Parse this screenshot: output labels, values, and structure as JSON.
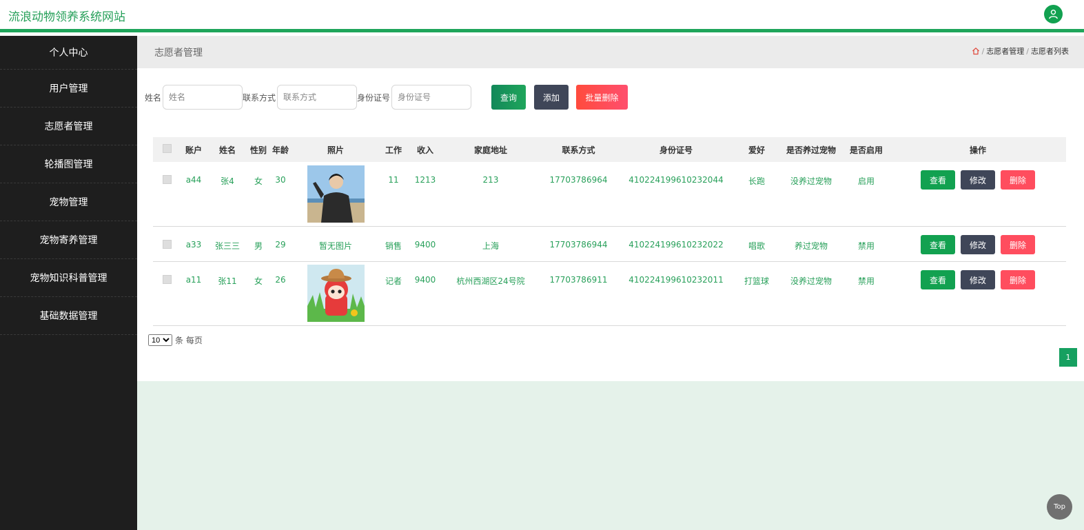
{
  "site_title": "流浪动物领养系统网站",
  "sidebar": {
    "items": [
      {
        "label": "个人中心"
      },
      {
        "label": "用户管理"
      },
      {
        "label": "志愿者管理"
      },
      {
        "label": "轮播图管理"
      },
      {
        "label": "宠物管理"
      },
      {
        "label": "宠物寄养管理"
      },
      {
        "label": "宠物知识科普管理"
      },
      {
        "label": "基础数据管理"
      }
    ]
  },
  "page": {
    "title": "志愿者管理",
    "breadcrumb": [
      "志愿者管理",
      "志愿者列表"
    ]
  },
  "search": {
    "name_label": "姓名",
    "name_placeholder": "姓名",
    "phone_label": "联系方式",
    "phone_placeholder": "联系方式",
    "id_label": "身份证号",
    "id_placeholder": "身份证号",
    "query_btn": "查询",
    "add_btn": "添加",
    "batch_delete_btn": "批量删除"
  },
  "table": {
    "headers": [
      "账户",
      "姓名",
      "性别",
      "年龄",
      "照片",
      "工作",
      "收入",
      "家庭地址",
      "联系方式",
      "身份证号",
      "爱好",
      "是否养过宠物",
      "是否启用",
      "操作"
    ],
    "rows": [
      {
        "account": "a44",
        "name": "张4",
        "sex": "女",
        "age": "30",
        "photo": "person-photo",
        "photo_text": "",
        "job": "11",
        "income": "1213",
        "address": "213",
        "phone": "17703786964",
        "idno": "410224199610232044",
        "hobby": "长跑",
        "had_pet": "没养过宠物",
        "enabled": "启用"
      },
      {
        "account": "a33",
        "name": "张三三",
        "sex": "男",
        "age": "29",
        "photo": "",
        "photo_text": "暂无图片",
        "job": "销售",
        "income": "9400",
        "address": "上海",
        "phone": "17703786944",
        "idno": "410224199610232022",
        "hobby": "唱歌",
        "had_pet": "养过宠物",
        "enabled": "禁用"
      },
      {
        "account": "a11",
        "name": "张11",
        "sex": "女",
        "age": "26",
        "photo": "cartoon-photo",
        "photo_text": "",
        "job": "记者",
        "income": "9400",
        "address": "杭州西湖区24号院",
        "phone": "17703786911",
        "idno": "410224199610232011",
        "hobby": "打篮球",
        "had_pet": "没养过宠物",
        "enabled": "禁用"
      }
    ],
    "actions": {
      "view": "查看",
      "edit": "修改",
      "delete": "删除"
    }
  },
  "pagination": {
    "page_size": "10",
    "per_page_text": "条 每页",
    "current_page": "1"
  },
  "back_to_top": "Top",
  "colors": {
    "brand": "#1fa55b",
    "view": "#12a150",
    "edit": "#3f4658",
    "delete": "#ff4d5e"
  }
}
